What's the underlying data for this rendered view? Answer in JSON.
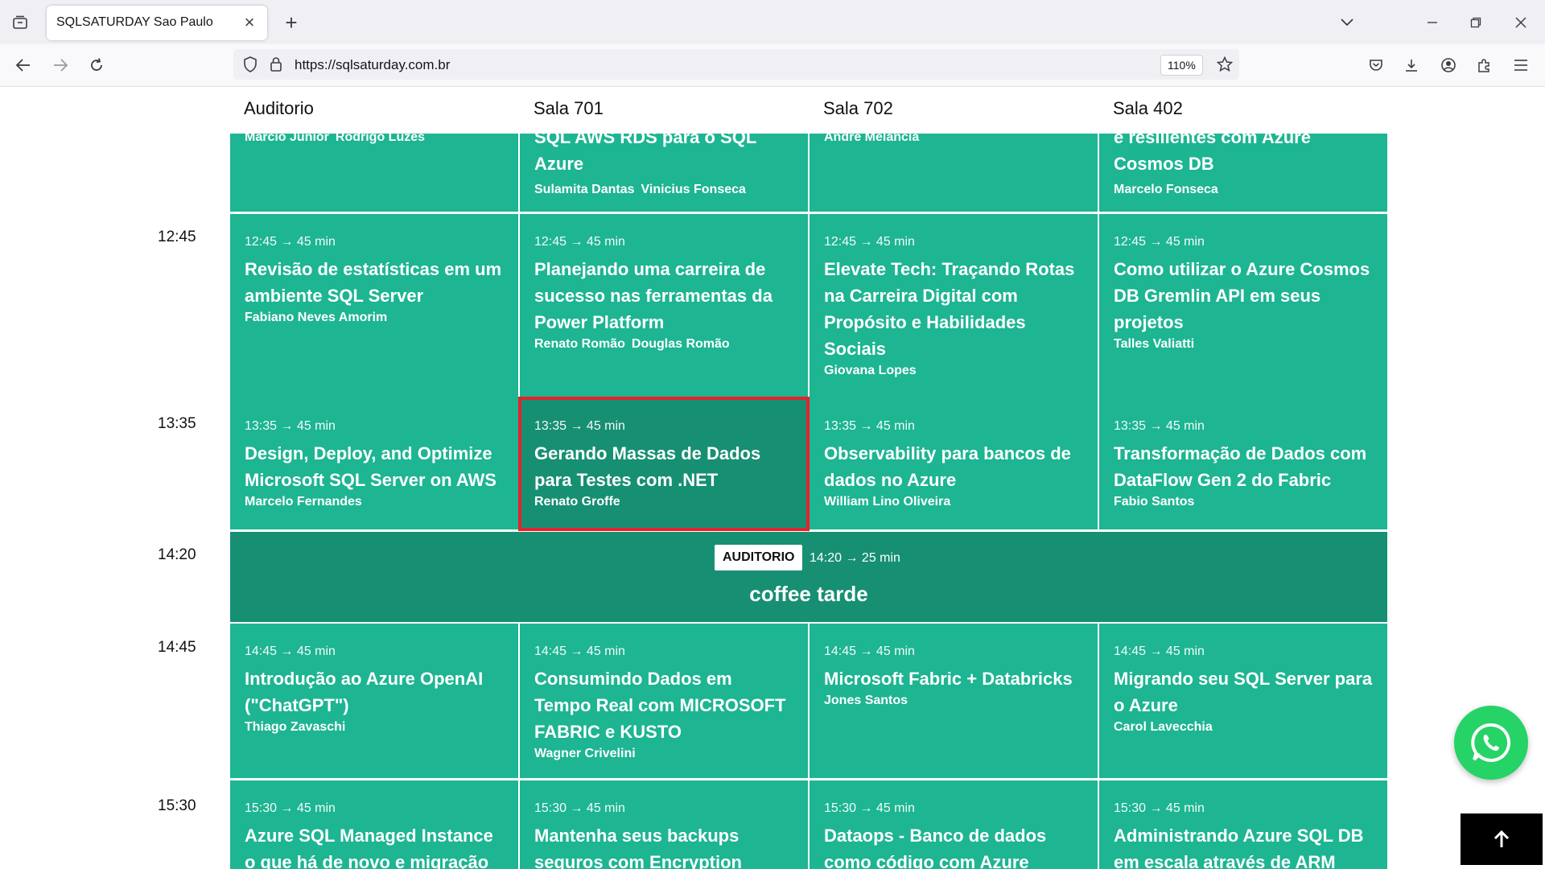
{
  "browser": {
    "tab_title": "SQLSATURDAY Sao Paulo",
    "url": "https://sqlsaturday.com.br",
    "zoom": "110%"
  },
  "rooms": [
    "Auditorio",
    "Sala 701",
    "Sala 702",
    "Sala 402"
  ],
  "partial_row": [
    {
      "title": "",
      "speakers": [
        "Marcio Junior",
        "Rodrigo Luzes"
      ]
    },
    {
      "title": "SQL AWS RDS para o SQL Azure",
      "speakers": [
        "Sulamita Dantas",
        "Vinicius Fonseca"
      ]
    },
    {
      "title": "",
      "speakers": [
        "Andre Melancia"
      ]
    },
    {
      "title": "e resilientes com Azure Cosmos DB",
      "speakers": [
        "Marcelo Fonseca"
      ]
    }
  ],
  "times": [
    "12:45",
    "13:35",
    "14:20",
    "14:45",
    "15:30"
  ],
  "slots": [
    {
      "time": "12:45",
      "sessions": [
        {
          "meta": "12:45 → 45 min",
          "title": "Revisão de estatísticas em um ambiente SQL Server",
          "speakers": [
            "Fabiano Neves Amorim"
          ]
        },
        {
          "meta": "12:45 → 45 min",
          "title": "Planejando uma carreira de sucesso nas ferramentas da Power Platform",
          "speakers": [
            "Renato Romão",
            "Douglas Romão"
          ]
        },
        {
          "meta": "12:45 → 45 min",
          "title": "Elevate Tech: Traçando Rotas na Carreira Digital com Propósito e Habilidades Sociais",
          "speakers": [
            "Giovana Lopes"
          ]
        },
        {
          "meta": "12:45 → 45 min",
          "title": "Como utilizar o Azure Cosmos DB Gremlin API em seus projetos",
          "speakers": [
            "Talles Valiatti"
          ]
        }
      ]
    },
    {
      "time": "13:35",
      "sessions": [
        {
          "meta": "13:35 → 45 min",
          "title": "Design, Deploy, and Optimize Microsoft SQL Server on AWS",
          "speakers": [
            "Marcelo Fernandes"
          ]
        },
        {
          "meta": "13:35 → 45 min",
          "title": "Gerando Massas de Dados para Testes com .NET",
          "speakers": [
            "Renato Groffe"
          ]
        },
        {
          "meta": "13:35 → 45 min",
          "title": "Observability para bancos de dados no Azure",
          "speakers": [
            "William Lino Oliveira"
          ]
        },
        {
          "meta": "13:35 → 45 min",
          "title": "Transformação de Dados com DataFlow Gen 2 do Fabric",
          "speakers": [
            "Fabio Santos"
          ]
        }
      ]
    },
    {
      "time": "14:45",
      "sessions": [
        {
          "meta": "14:45 → 45 min",
          "title": "Introdução ao Azure OpenAI (\"ChatGPT\")",
          "speakers": [
            "Thiago Zavaschi"
          ]
        },
        {
          "meta": "14:45 → 45 min",
          "title": "Consumindo Dados em Tempo Real com MICROSOFT FABRIC e KUSTO",
          "speakers": [
            "Wagner Crivelini"
          ]
        },
        {
          "meta": "14:45 → 45 min",
          "title": "Microsoft Fabric + Databricks",
          "speakers": [
            "Jones Santos"
          ]
        },
        {
          "meta": "14:45 → 45 min",
          "title": "Migrando seu SQL Server para o Azure",
          "speakers": [
            "Carol Lavecchia"
          ]
        }
      ]
    },
    {
      "time": "15:30",
      "sessions": [
        {
          "meta": "15:30 → 45 min",
          "title": "Azure SQL Managed Instance o que há de novo e migração",
          "speakers": []
        },
        {
          "meta": "15:30 → 45 min",
          "title": "Mantenha seus backups seguros com Encryption",
          "speakers": []
        },
        {
          "meta": "15:30 → 45 min",
          "title": "Dataops - Banco de dados como código com Azure",
          "speakers": []
        },
        {
          "meta": "15:30 → 45 min",
          "title": "Administrando Azure SQL DB em escala através de ARM",
          "speakers": []
        }
      ]
    }
  ],
  "break": {
    "badge": "AUDITORIO",
    "meta": "14:20 → 25 min",
    "title": "coffee tarde"
  },
  "colors": {
    "session": "#1db592",
    "break": "#178f73",
    "highlight_border": "#e3232c",
    "whatsapp": "#25d366"
  }
}
